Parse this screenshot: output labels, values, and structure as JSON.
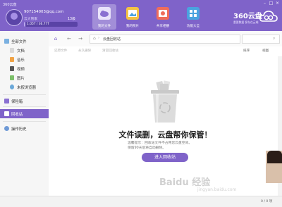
{
  "app": {
    "title": "360云盘"
  },
  "user": {
    "email": "907154003@qq.com",
    "level": "云大管家",
    "quota_text": "1.05T / 36.77T",
    "quota_fraction": 0.03,
    "quota_extra": "13级"
  },
  "nav_tabs": [
    {
      "label": "我的文件",
      "icon": "cloud-folder-icon",
      "active": true
    },
    {
      "label": "我的照片",
      "icon": "photo-icon"
    },
    {
      "label": "共享相册",
      "icon": "share-album-icon"
    },
    {
      "label": "功能大全",
      "icon": "apps-icon"
    }
  ],
  "brand": {
    "name": "360云盘",
    "slogan": "重要数据 保存在云端"
  },
  "window_controls": [
    "–",
    "□",
    "×"
  ],
  "sidebar": {
    "items": [
      {
        "label": "全部文件",
        "icon": "all-files-icon"
      },
      {
        "label": "文档",
        "icon": "doc-icon"
      },
      {
        "label": "音乐",
        "icon": "music-icon"
      },
      {
        "label": "视频",
        "icon": "video-icon"
      },
      {
        "label": "图片",
        "icon": "image-icon"
      },
      {
        "label": "未按浏览器",
        "icon": "browser-icon"
      },
      {
        "label": "保险箱",
        "icon": "safe-icon"
      },
      {
        "label": "回收站",
        "icon": "recycle-icon",
        "active": true
      },
      {
        "label": "操作历史",
        "icon": "history-icon"
      }
    ]
  },
  "toolbar": {
    "breadcrumb": "云盘回收站",
    "search_placeholder": ""
  },
  "subbar": {
    "actions": [
      "还原文件",
      "永久删除",
      "清空回收站"
    ],
    "sort_label": "排序",
    "view_label": "视图"
  },
  "empty_state": {
    "title": "文件误删，云盘帮你保管！",
    "desc_line1": "温馨提示：回收站文件不占用您云盘空间。",
    "desc_line2": "保留90天后将自动删除。",
    "button_label": "进入回收站"
  },
  "status": {
    "right_text": "0 / 0 项"
  },
  "watermark": {
    "text": "Baidu 经验",
    "sub": "jingyan.baidu.com"
  },
  "colors": {
    "accent": "#7f63c9",
    "header": "#7f63c9"
  }
}
